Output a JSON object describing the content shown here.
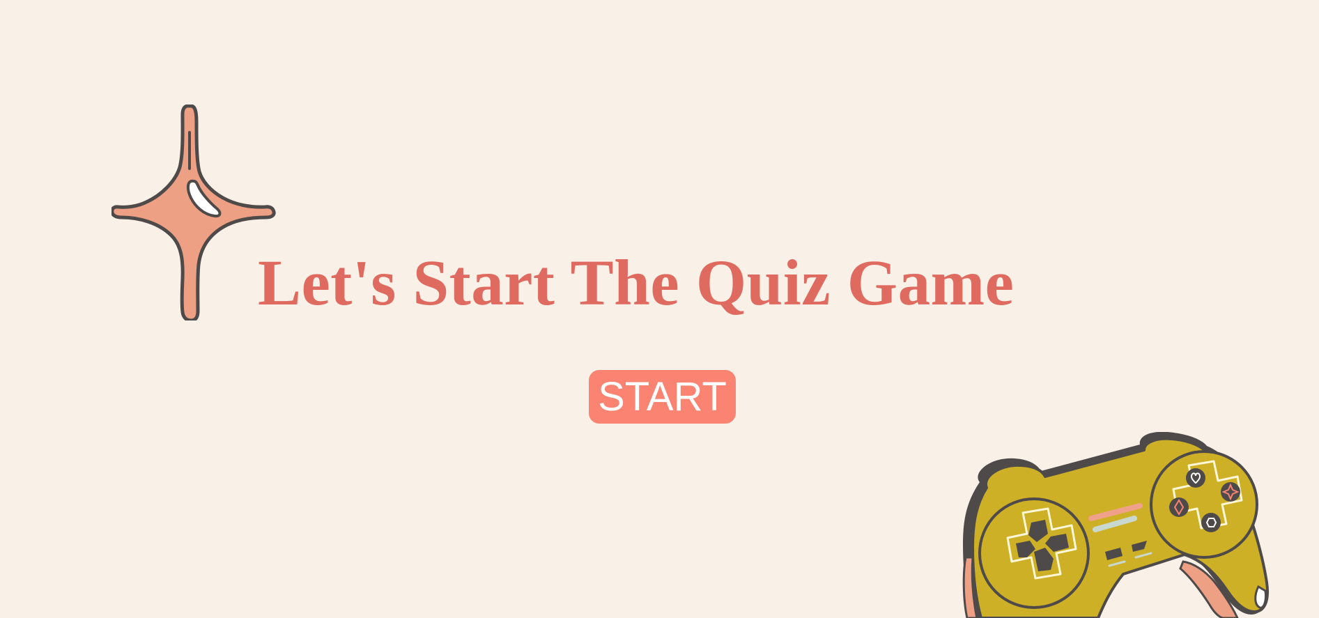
{
  "title": "Let's Start The Quiz Game",
  "start_button": {
    "label": "START"
  },
  "decorations": {
    "sparkle_icon": "four-point-star-icon",
    "controller_icon": "gamepad-icon"
  },
  "colors": {
    "background": "#f9f0e7",
    "title": "#df6b60",
    "button": "#fa8372",
    "button_text": "#ffffff",
    "sparkle_fill": "#eda083",
    "controller_fill": "#cdb026",
    "outline": "#4f4a4a"
  }
}
